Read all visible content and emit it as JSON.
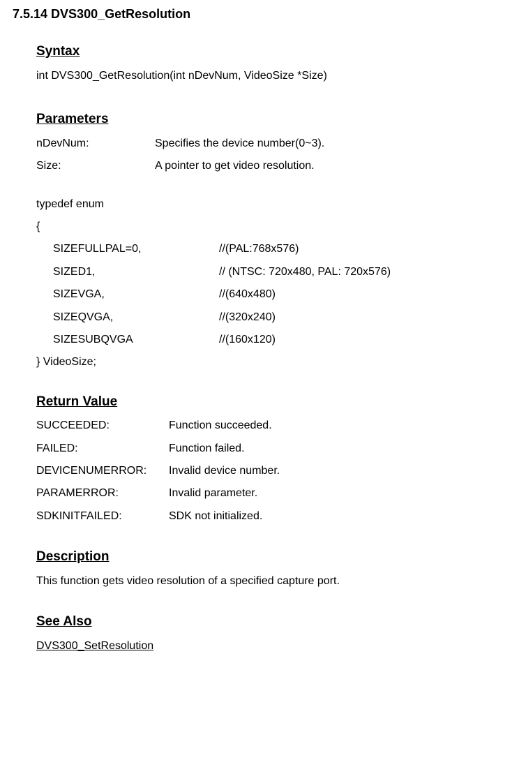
{
  "title": "7.5.14 DVS300_GetResolution",
  "syntax": {
    "heading": "Syntax",
    "text": "int DVS300_GetResolution(int nDevNum, VideoSize *Size)"
  },
  "parameters": {
    "heading": "Parameters",
    "items": [
      {
        "name": "nDevNum:",
        "desc": "Specifies the device number(0~3)."
      },
      {
        "name": "Size:",
        "desc": "A pointer to get video resolution."
      }
    ]
  },
  "enum": {
    "typedef": "typedef enum",
    "open": "{",
    "items": [
      {
        "name": "SIZEFULLPAL=0,",
        "comment": "//(PAL:768x576)"
      },
      {
        "name": "SIZED1,",
        "comment": "// (NTSC: 720x480, PAL: 720x576)"
      },
      {
        "name": "SIZEVGA,",
        "comment": "//(640x480)"
      },
      {
        "name": "SIZEQVGA,",
        "comment": "//(320x240)"
      },
      {
        "name": "SIZESUBQVGA",
        "comment": "//(160x120)"
      }
    ],
    "close": "} VideoSize;"
  },
  "returnValue": {
    "heading": "Return Value",
    "items": [
      {
        "name": "SUCCEEDED:",
        "desc": "Function succeeded."
      },
      {
        "name": "FAILED:",
        "desc": "Function failed."
      },
      {
        "name": "DEVICENUMERROR:",
        "desc": "Invalid device number."
      },
      {
        "name": "PARAMERROR:",
        "desc": "Invalid parameter."
      },
      {
        "name": "SDKINITFAILED:",
        "desc": "SDK not initialized."
      }
    ]
  },
  "description": {
    "heading": "Description",
    "text": "This function gets video resolution of a specified capture port."
  },
  "seeAlso": {
    "heading": "See Also",
    "link": "DVS300_SetResolution"
  }
}
